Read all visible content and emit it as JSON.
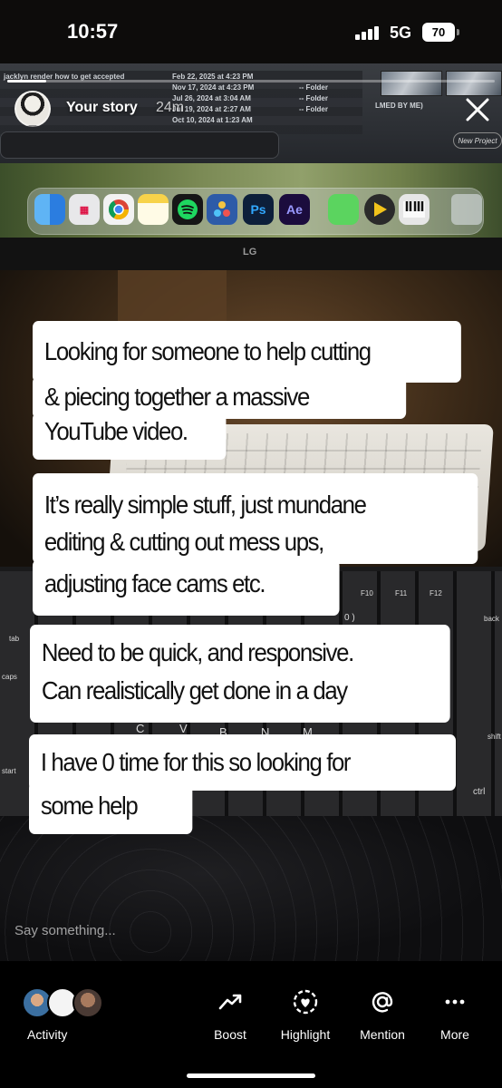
{
  "status_bar": {
    "time": "10:57",
    "network": "5G",
    "battery": "70"
  },
  "story": {
    "progress": 0.08,
    "title": "Your story",
    "age": "24m",
    "close_icon": "close-icon"
  },
  "background_photo": {
    "finder_rows": [
      "Feb 22, 2025 at 4:23 PM",
      "jacklyn render how to get accepted",
      "Nov 17, 2024 at 4:23 PM",
      "Jul 26, 2024 at 3:04 AM",
      "Jul 19, 2024 at 2:27 AM",
      "Oct 10, 2024 at 1:23 AM"
    ],
    "finder_kind": "-- Folder",
    "thumb_caption": "LMED BY ME)",
    "new_project": "New Project",
    "monitor_brand": "LG",
    "dock_apps": [
      "Finder",
      "Launchpad",
      "Chrome",
      "Notes",
      "Spotify",
      "DaVinci Resolve",
      "Ps",
      "Ae",
      "Messages",
      "Final Cut",
      "Piano",
      "Trash"
    ],
    "keyboard_keys": [
      "F10",
      "F11",
      "F12",
      "0 )",
      "tab",
      "caps",
      "start",
      "C",
      "V",
      "B",
      "N",
      "M",
      "back",
      "shift",
      "ctrl"
    ]
  },
  "captions": {
    "block1": [
      "Looking for someone to help cutting",
      "& piecing together a massive",
      "YouTube video."
    ],
    "block2": [
      "It’s really simple stuff, just mundane",
      "editing & cutting out mess ups,",
      "adjusting face cams etc."
    ],
    "block3": [
      "Need to be quick, and responsive.",
      "Can realistically get done in a day"
    ],
    "block4": [
      "I have 0 time for this so looking for",
      "some help"
    ]
  },
  "reply_placeholder": "Say something...",
  "bottom_nav": {
    "activity_label": "Activity",
    "items": [
      {
        "label": "Boost",
        "icon": "trending-up-icon"
      },
      {
        "label": "Highlight",
        "icon": "heart-circle-icon"
      },
      {
        "label": "Mention",
        "icon": "at-sign-icon"
      },
      {
        "label": "More",
        "icon": "more-dots-icon"
      }
    ]
  }
}
